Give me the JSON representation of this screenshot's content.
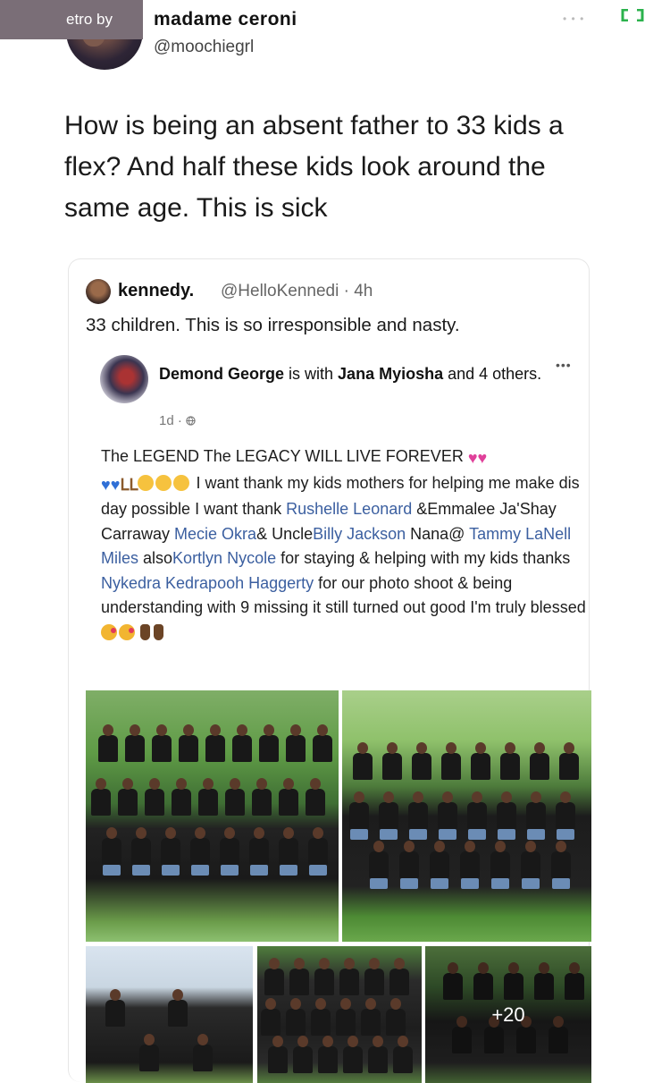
{
  "header": {
    "overlay_label": "etro by",
    "display_name": "madame ceroni",
    "handle": "@moochiegrl",
    "more_glyph": "• • •",
    "accent_color": "#2bb24c"
  },
  "tweet": {
    "text": "How is being an absent father to 33 kids a flex? And half these kids look around the same age. This is sick"
  },
  "quote": {
    "name": "kennedy.",
    "handle_time": "@HelloKennedi · 4h",
    "text": "33 children. This is so irresponsible and nasty."
  },
  "fb_post": {
    "author": "Demond George",
    "is_with": " is with ",
    "tagged": "Jana Myiosha",
    "and_others": " and 4 others.",
    "time": "1d · ",
    "more_glyph": "•••",
    "body": {
      "line1": "The LEGEND The LEGACY WILL  LIVE FOREVER ",
      "t2": " I want thank my kids mothers for helping me make dis day possible I want thank ",
      "link1": "Rushelle Leonard",
      "t3": " &Emmalee Ja'Shay Carraway ",
      "link2": "Mecie Okra",
      "t4": "& Uncle",
      "link3": "Billy Jackson",
      "t5": " Nana@ ",
      "link4": "Tammy LaNell Miles",
      "t6": " also",
      "link5": "Kortlyn Nycole",
      "t7": " for staying & helping with my kids thanks ",
      "link6": "Nykedra Kedrapooh Haggerty",
      "t8": " for our photo shoot & being understanding with 9 missing it still turned out good I'm truly blessed "
    },
    "more_photos": "+20"
  },
  "icons": {
    "header_more": "more-horizontal-icon",
    "expand": "expand-icon",
    "globe": "globe-icon",
    "hearts": "heart-icon",
    "muscle": "flexed-biceps-icon",
    "smile": "smiling-face-icon",
    "kiss": "face-blowing-kiss-icon",
    "fingers": "crossed-fingers-icon"
  }
}
